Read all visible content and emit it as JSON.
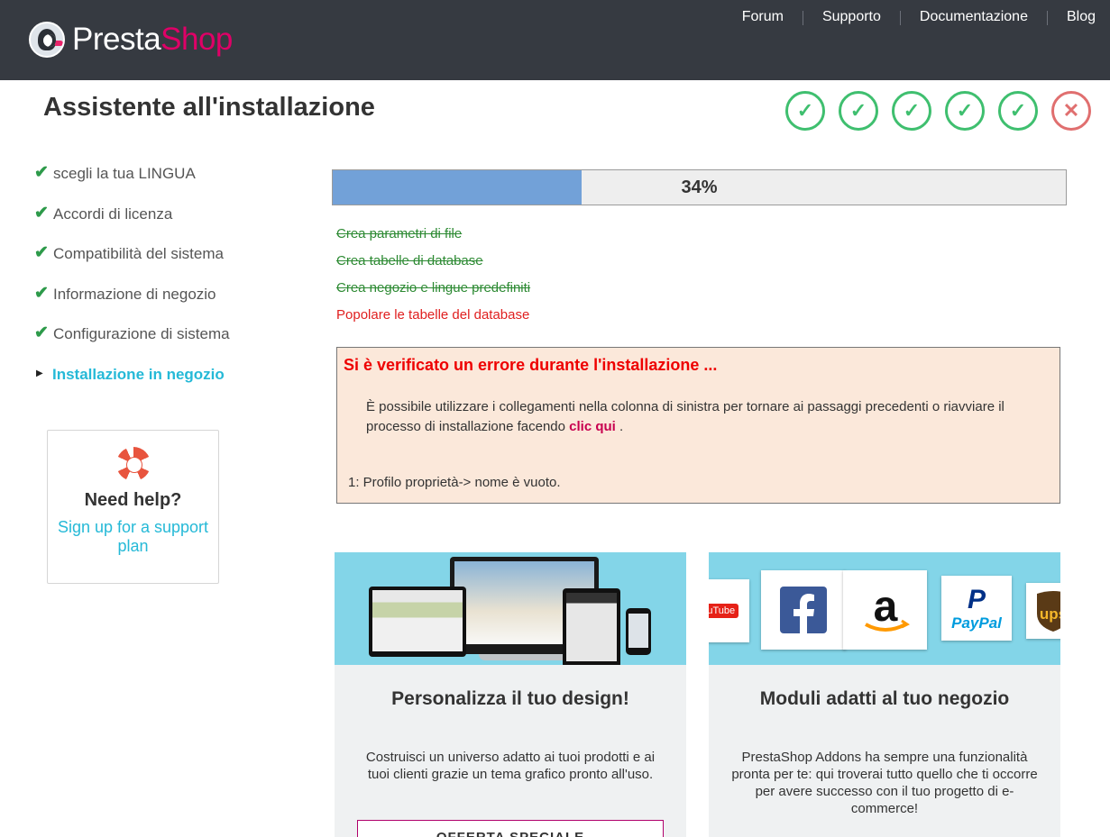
{
  "brand": {
    "logo_part1": "Presta",
    "logo_part2": "Shop"
  },
  "topnav": [
    "Forum",
    "Supporto",
    "Documentazione",
    "Blog"
  ],
  "page_title": "Assistente all'installazione",
  "step_indicators": [
    "done",
    "done",
    "done",
    "done",
    "done",
    "error"
  ],
  "sidebar": {
    "items": [
      {
        "label": "scegli la tua LINGUA",
        "state": "done"
      },
      {
        "label": "Accordi di licenza",
        "state": "done"
      },
      {
        "label": "Compatibilità del sistema",
        "state": "done"
      },
      {
        "label": "Informazione di negozio",
        "state": "done"
      },
      {
        "label": "Configurazione di sistema",
        "state": "done"
      },
      {
        "label": "Installazione in negozio",
        "state": "active"
      }
    ]
  },
  "help": {
    "title": "Need help?",
    "link": "Sign up for a support plan"
  },
  "progress": {
    "value": 0.34,
    "label": "34%"
  },
  "tasks": [
    {
      "label": "Crea parametri di file",
      "state": "done"
    },
    {
      "label": "Crea tabelle di database",
      "state": "done"
    },
    {
      "label": "Crea negozio e lingue predefiniti",
      "state": "done"
    },
    {
      "label": "Popolare le tabelle del database",
      "state": "failed"
    }
  ],
  "error": {
    "title": "Si è verificato un errore durante l'installazione ...",
    "message_before": "È possibile utilizzare i collegamenti nella colonna di sinistra per tornare ai passaggi precedenti o riavviare il processo di installazione facendo ",
    "link": "clic qui",
    "message_after": " .",
    "detail": "1: Profilo proprietà-> nome è vuoto."
  },
  "cards": [
    {
      "title": "Personalizza il tuo design!",
      "text": "Costruisci un universo adatto ai tuoi prodotti e ai tuoi clienti grazie un tema grafico pronto all'uso.",
      "button": "OFFERTA SPECIALE"
    },
    {
      "title": "Moduli adatti al tuo negozio",
      "text": "PrestaShop Addons ha sempre una funzionalità pronta per te: qui troverai tutto quello che ti occorre per avere successo con il tuo progetto di e-commerce!"
    }
  ],
  "card_logos": [
    "YouTube",
    "Facebook",
    "Amazon",
    "PayPal",
    "UPS"
  ],
  "colors": {
    "header": "#363a41",
    "brand_pink": "#df0067",
    "accent": "#25b9d7",
    "success": "#3fbf6f",
    "error": "#e00000",
    "error_bg": "#fbe8da",
    "progress_fill": "#72a1d8"
  }
}
